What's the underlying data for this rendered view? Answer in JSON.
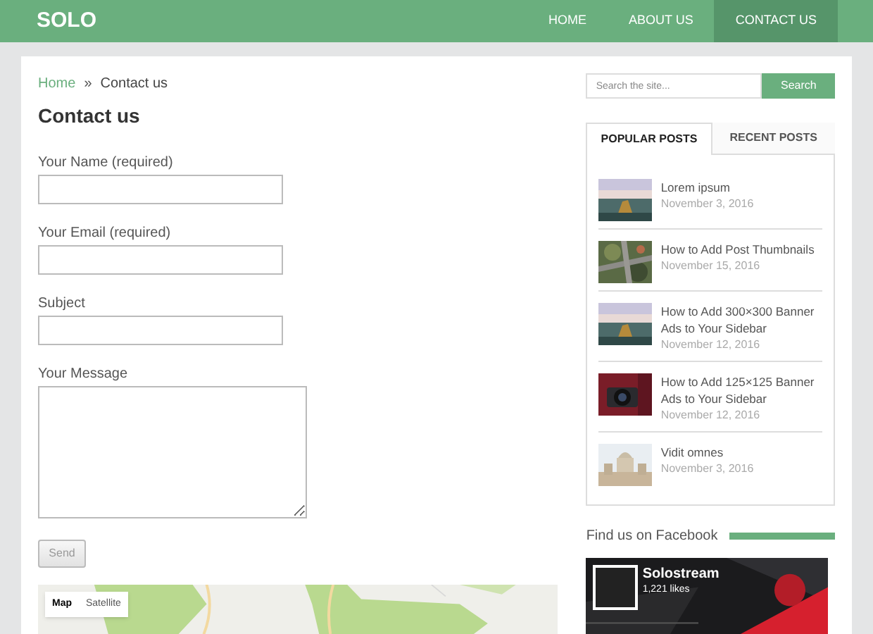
{
  "header": {
    "site_title": "SOLO",
    "nav": [
      {
        "label": "HOME",
        "selected": false
      },
      {
        "label": "ABOUT US",
        "selected": false
      },
      {
        "label": "CONTACT US",
        "selected": true
      }
    ]
  },
  "breadcrumb": {
    "home": "Home",
    "separator": "»",
    "current": "Contact us"
  },
  "page_title": "Contact us",
  "form": {
    "fields": [
      {
        "label": "Your Name (required)",
        "kind": "input"
      },
      {
        "label": "Your Email (required)",
        "kind": "input"
      },
      {
        "label": "Subject",
        "kind": "input"
      },
      {
        "label": "Your Message",
        "kind": "textarea"
      }
    ],
    "submit": {
      "label": "Send",
      "disabled": true
    }
  },
  "map": {
    "buttons": [
      {
        "label": "Map",
        "selected": true
      },
      {
        "label": "Satellite",
        "selected": false
      }
    ]
  },
  "sidebar": {
    "search": {
      "placeholder": "Search the site...",
      "button": "Search"
    },
    "tabs": [
      {
        "label": "POPULAR POSTS",
        "selected": true
      },
      {
        "label": "RECENT POSTS",
        "selected": false
      }
    ],
    "posts": [
      {
        "title": "Lorem ipsum",
        "date": "November 3, 2016"
      },
      {
        "title": "How to Add Post Thumbnails",
        "date": "November 15, 2016"
      },
      {
        "title": "How to Add 300×300 Banner Ads to Your Sidebar",
        "date": "November 12, 2016"
      },
      {
        "title": "How to Add 125×125 Banner Ads to Your Sidebar",
        "date": "November 12, 2016"
      },
      {
        "title": "Vidit omnes",
        "date": "November 3, 2016"
      }
    ],
    "facebook": {
      "heading": "Find us on Facebook",
      "page_name": "Solostream",
      "likes": "1,221 likes"
    }
  }
}
